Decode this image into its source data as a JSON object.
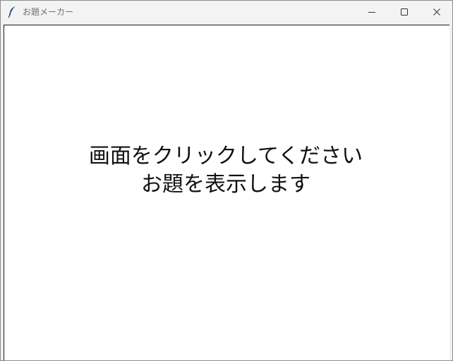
{
  "window": {
    "title": "お題メーカー",
    "icon": "feather-icon",
    "controls": [
      "minimize-icon",
      "maximize-icon",
      "close-icon"
    ]
  },
  "canvas": {
    "line1": "画面をクリックしてください",
    "line2": "お題を表示します",
    "background_color": "#ffffff",
    "text_color": "#111111"
  }
}
